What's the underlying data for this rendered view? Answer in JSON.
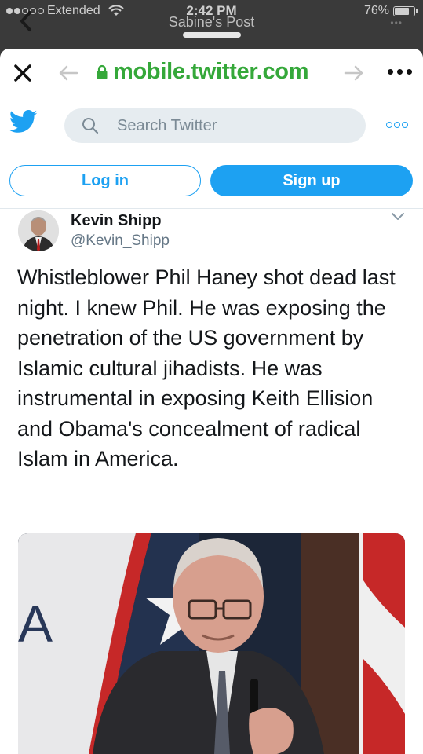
{
  "status_bar": {
    "carrier": "Extended",
    "time": "2:42 PM",
    "battery": "76%",
    "battery_level": 0.76
  },
  "page_title": "Sabine's Post",
  "browser": {
    "url": "mobile.twitter.com"
  },
  "twitter": {
    "search_placeholder": "Search Twitter",
    "login_label": "Log in",
    "signup_label": "Sign up",
    "brand_color": "#1da1f2"
  },
  "tweet": {
    "author_name": "Kevin Shipp",
    "author_handle": "@Kevin_Shipp",
    "text": "Whistleblower Phil Haney shot dead last night. I knew Phil. He was exposing the penetration of the US government by Islamic cultural jihadists. He was instrumental in exposing Keith Ellision and Obama's concealment of radical Islam in America.",
    "media_letter": "A"
  },
  "icons": [
    "back-chevron-icon",
    "wifi-icon",
    "battery-icon",
    "close-icon",
    "nav-back-icon",
    "lock-icon",
    "nav-forward-icon",
    "more-icon",
    "twitter-bird-icon",
    "search-icon",
    "chevron-down-icon"
  ]
}
